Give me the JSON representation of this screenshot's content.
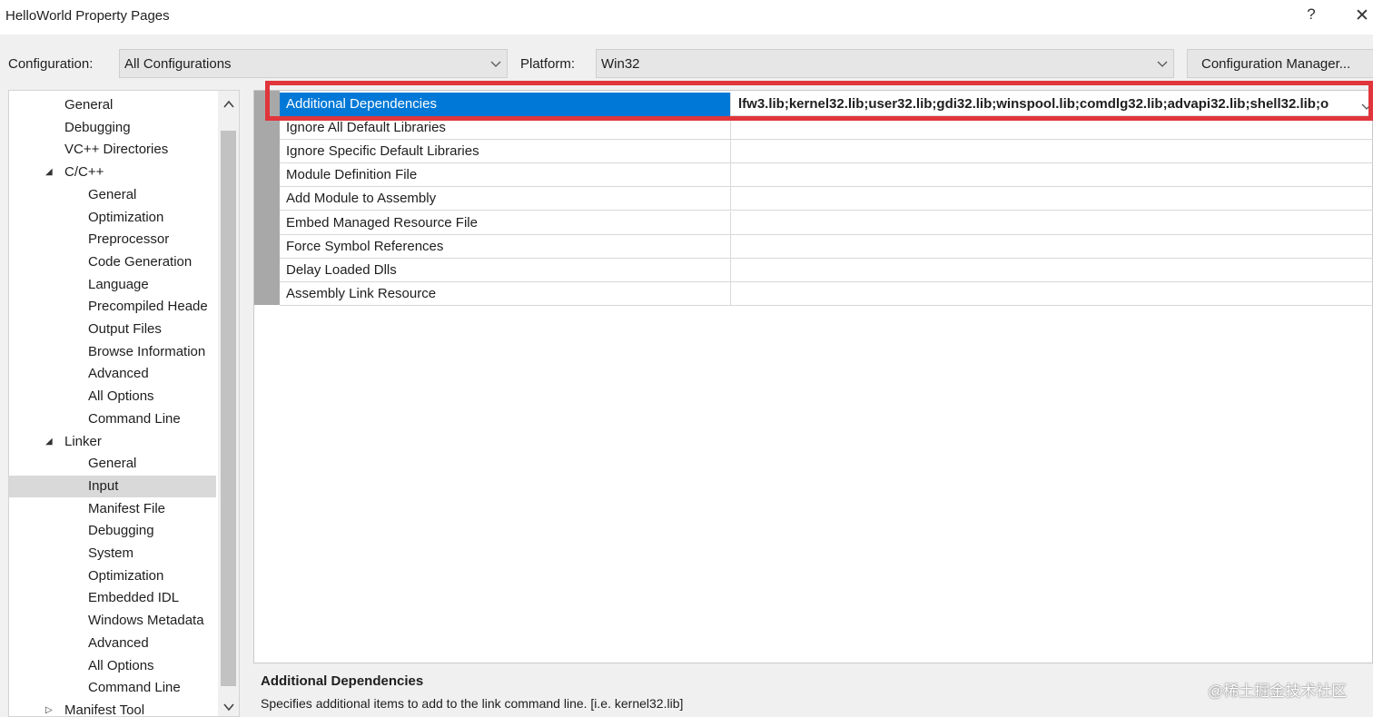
{
  "window": {
    "title": "HelloWorld Property Pages",
    "help_label": "?",
    "close_label": "✕"
  },
  "toolbar": {
    "configuration_label": "Configuration:",
    "configuration_value": "All Configurations",
    "platform_label": "Platform:",
    "platform_value": "Win32",
    "config_manager_label": "Configuration Manager..."
  },
  "tree": {
    "items": [
      {
        "label": "General",
        "level": 1
      },
      {
        "label": "Debugging",
        "level": 1
      },
      {
        "label": "VC++ Directories",
        "level": 1
      },
      {
        "label": "C/C++",
        "level": 1,
        "expanded": true
      },
      {
        "label": "General",
        "level": 2
      },
      {
        "label": "Optimization",
        "level": 2
      },
      {
        "label": "Preprocessor",
        "level": 2
      },
      {
        "label": "Code Generation",
        "level": 2
      },
      {
        "label": "Language",
        "level": 2
      },
      {
        "label": "Precompiled Heade",
        "level": 2
      },
      {
        "label": "Output Files",
        "level": 2
      },
      {
        "label": "Browse Information",
        "level": 2
      },
      {
        "label": "Advanced",
        "level": 2
      },
      {
        "label": "All Options",
        "level": 2
      },
      {
        "label": "Command Line",
        "level": 2
      },
      {
        "label": "Linker",
        "level": 1,
        "expanded": true
      },
      {
        "label": "General",
        "level": 2
      },
      {
        "label": "Input",
        "level": 2,
        "selected": true
      },
      {
        "label": "Manifest File",
        "level": 2
      },
      {
        "label": "Debugging",
        "level": 2
      },
      {
        "label": "System",
        "level": 2
      },
      {
        "label": "Optimization",
        "level": 2
      },
      {
        "label": "Embedded IDL",
        "level": 2
      },
      {
        "label": "Windows Metadata",
        "level": 2
      },
      {
        "label": "Advanced",
        "level": 2
      },
      {
        "label": "All Options",
        "level": 2
      },
      {
        "label": "Command Line",
        "level": 2
      },
      {
        "label": "Manifest Tool",
        "level": 1,
        "expanded": false
      }
    ]
  },
  "properties": [
    {
      "name": "Additional Dependencies",
      "value": "lfw3.lib;kernel32.lib;user32.lib;gdi32.lib;winspool.lib;comdlg32.lib;advapi32.lib;shell32.lib;o",
      "selected": true
    },
    {
      "name": "Ignore All Default Libraries",
      "value": ""
    },
    {
      "name": "Ignore Specific Default Libraries",
      "value": ""
    },
    {
      "name": "Module Definition File",
      "value": ""
    },
    {
      "name": "Add Module to Assembly",
      "value": ""
    },
    {
      "name": "Embed Managed Resource File",
      "value": ""
    },
    {
      "name": "Force Symbol References",
      "value": ""
    },
    {
      "name": "Delay Loaded Dlls",
      "value": ""
    },
    {
      "name": "Assembly Link Resource",
      "value": ""
    }
  ],
  "description": {
    "title": "Additional Dependencies",
    "text": "Specifies additional items to add to the link command line. [i.e. kernel32.lib]"
  },
  "watermark": "@稀土掘金技术社区",
  "colors": {
    "selection": "#0078d7",
    "highlight_box": "#e0353b"
  }
}
